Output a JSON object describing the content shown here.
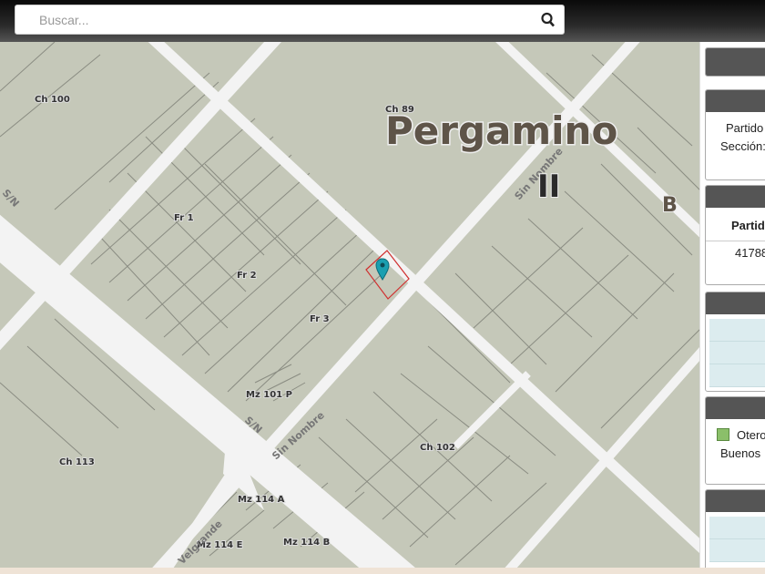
{
  "search": {
    "placeholder": "Buscar..."
  },
  "map": {
    "city_label": "Pergamino",
    "section_label": "II",
    "zone_label": "B",
    "parcels": [
      "Ch 100",
      "Ch 89",
      "Fr 1",
      "Fr 2",
      "Fr 3",
      "Mz 101 P",
      "Ch 113",
      "Ch 102",
      "Mz 114 A",
      "Mz 114 E",
      "Mz 114 B"
    ],
    "roads": [
      "Sin Nombre",
      "Sin Nombre",
      "S/N",
      "S/N",
      "Velgrande"
    ]
  },
  "panel": {
    "card1": {
      "line1": "Partido",
      "line2": "Sección:"
    },
    "card2": {
      "header": "Partid",
      "value": "41788"
    },
    "card4": {
      "line1": "Otero",
      "line2": "Buenos"
    }
  },
  "colors": {
    "map_bg": "#c5c8b9",
    "road": "#f3f3f3",
    "marker": "#1a9fb0",
    "selected_parcel": "#d03030"
  }
}
